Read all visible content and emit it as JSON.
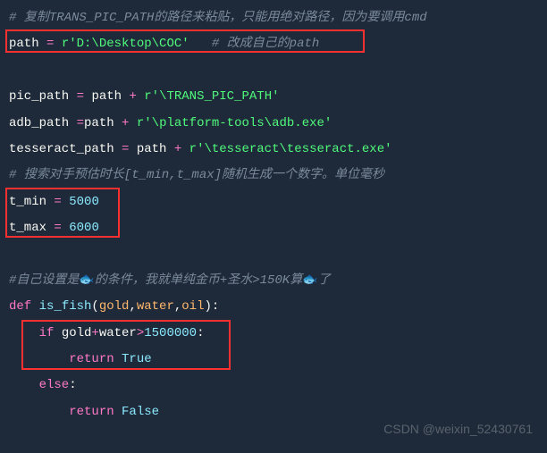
{
  "lines": {
    "c1": "# 复制TRANS_PIC_PATH的路径来粘贴，只能用绝对路径，因为要调用cmd",
    "l2_var": "path ",
    "l2_op": "= ",
    "l2_str": "r'D:\\Desktop\\COC'",
    "l2_comment": "   # 改成自己的path",
    "l3_var": "pic_path ",
    "l3_op": "= ",
    "l3_rhs": "path ",
    "l3_op2": "+ ",
    "l3_str": "r'\\TRANS_PIC_PATH'",
    "l4_var": "adb_path ",
    "l4_op": "=",
    "l4_rhs": "path ",
    "l4_op2": "+ ",
    "l4_str": "r'\\platform-tools\\adb.exe'",
    "l5_var": "tesseract_path ",
    "l5_op": "= ",
    "l5_rhs": "path ",
    "l5_op2": "+ ",
    "l5_str": "r'\\tesseract\\tesseract.exe'",
    "c6": "# 搜索对手预估时长[t_min,t_max]随机生成一个数字。单位毫秒",
    "l7_var": "t_min ",
    "l7_op": "= ",
    "l7_num": "5000",
    "l8_var": "t_max ",
    "l8_op": "= ",
    "l8_num": "6000",
    "c9a": "#自己设置是",
    "c9fish": "🐟",
    "c9b": "的条件，我就单纯金币+圣水>150K算",
    "c9fish2": "🐟",
    "c9c": "了",
    "l10_def": "def ",
    "l10_fn": "is_fish",
    "l10_p1": "gold",
    "l10_p2": "water",
    "l10_p3": "oil",
    "l11_if": "    if ",
    "l11_expr": "gold",
    "l11_op": "+",
    "l11_expr2": "water",
    "l11_op2": ">",
    "l11_num": "1500000",
    "l12_ret": "        return ",
    "l12_bool": "True",
    "l13_else": "    else",
    "l14_ret": "        return ",
    "l14_bool": "False"
  },
  "watermark": "CSDN @weixin_52430761"
}
